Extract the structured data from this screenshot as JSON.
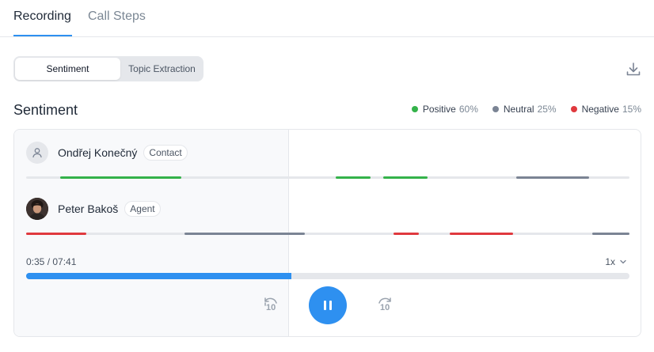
{
  "tabs": [
    {
      "label": "Recording",
      "active": true
    },
    {
      "label": "Call Steps",
      "active": false
    }
  ],
  "view_toggle": {
    "options": [
      "Sentiment",
      "Topic Extraction"
    ],
    "selected": "Sentiment"
  },
  "section": {
    "title": "Sentiment",
    "legend": [
      {
        "label": "Positive",
        "percent": "60%",
        "color": "#34b24a"
      },
      {
        "label": "Neutral",
        "percent": "25%",
        "color": "#7b8494"
      },
      {
        "label": "Negative",
        "percent": "15%",
        "color": "#e0393e"
      }
    ]
  },
  "speakers": [
    {
      "name": "Ondřej Konečný",
      "role": "Contact",
      "icon": "user-icon"
    },
    {
      "name": "Peter Bakoš",
      "role": "Agent",
      "icon": "avatar-photo"
    }
  ],
  "player": {
    "time": "0:35 / 07:41",
    "speed": "1x",
    "progress_fraction": 0.44,
    "skip_back_label": "10",
    "skip_forward_label": "10"
  },
  "colors": {
    "accent": "#2e90f0",
    "positive": "#34b24a",
    "neutral": "#7b8494",
    "negative": "#e0393e"
  }
}
